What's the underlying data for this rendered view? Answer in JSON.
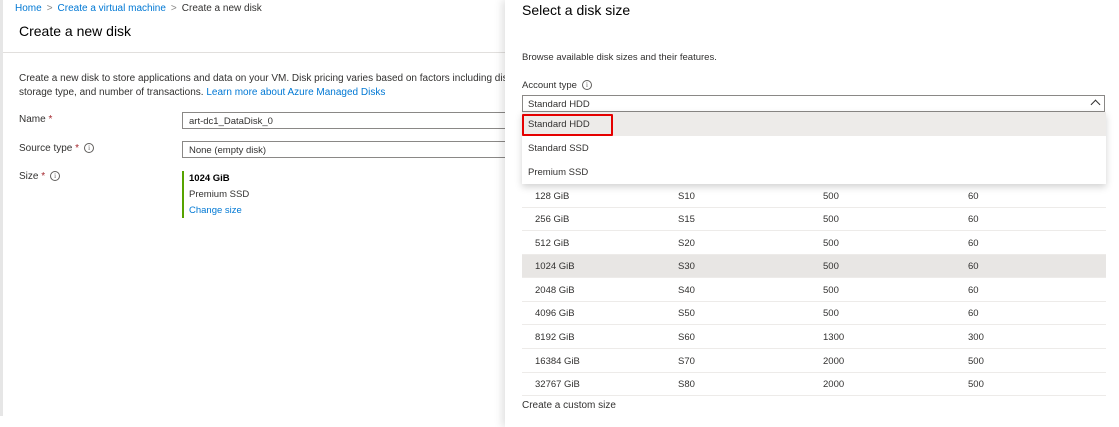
{
  "breadcrumb": [
    {
      "label": "Home",
      "link": true
    },
    {
      "label": "Create a virtual machine",
      "link": true
    },
    {
      "label": "Create a new disk",
      "link": false
    }
  ],
  "left": {
    "title": "Create a new disk",
    "description": "Create a new disk to store applications and data on your VM. Disk pricing varies based on factors including disk size, storage type, and number of transactions.",
    "learn_more": "Learn more about Azure Managed Disks",
    "name_label": "Name",
    "name_value": "art-dc1_DataDisk_0",
    "source_label": "Source type",
    "source_value": "None (empty disk)",
    "size_label": "Size",
    "size_value": "1024 GiB",
    "size_type": "Premium SSD",
    "change_size": "Change size"
  },
  "right": {
    "title": "Select a disk size",
    "description": "Browse available disk sizes and their features.",
    "account_type_label": "Account type",
    "account_type_value": "Standard HDD",
    "dropdown_options": [
      "Standard HDD",
      "Standard SSD",
      "Premium SSD"
    ],
    "rows": [
      [
        "128 GiB",
        "S10",
        "500",
        "60"
      ],
      [
        "256 GiB",
        "S15",
        "500",
        "60"
      ],
      [
        "512 GiB",
        "S20",
        "500",
        "60"
      ],
      [
        "1024 GiB",
        "S30",
        "500",
        "60"
      ],
      [
        "2048 GiB",
        "S40",
        "500",
        "60"
      ],
      [
        "4096 GiB",
        "S50",
        "500",
        "60"
      ],
      [
        "8192 GiB",
        "S60",
        "1300",
        "300"
      ],
      [
        "16384 GiB",
        "S70",
        "2000",
        "500"
      ],
      [
        "32767 GiB",
        "S80",
        "2000",
        "500"
      ]
    ],
    "selected_row": "1024 GiB",
    "custom_size": "Create a custom size"
  },
  "colors": {
    "link": "#0078d4",
    "required": "#a4262c",
    "highlight_box": "#e50000",
    "size_accent": "#57a300"
  },
  "icons": {
    "info": "info-icon",
    "breadcrumb_separator": "chevron-right-icon",
    "dropdown": "chevron-up-icon"
  }
}
